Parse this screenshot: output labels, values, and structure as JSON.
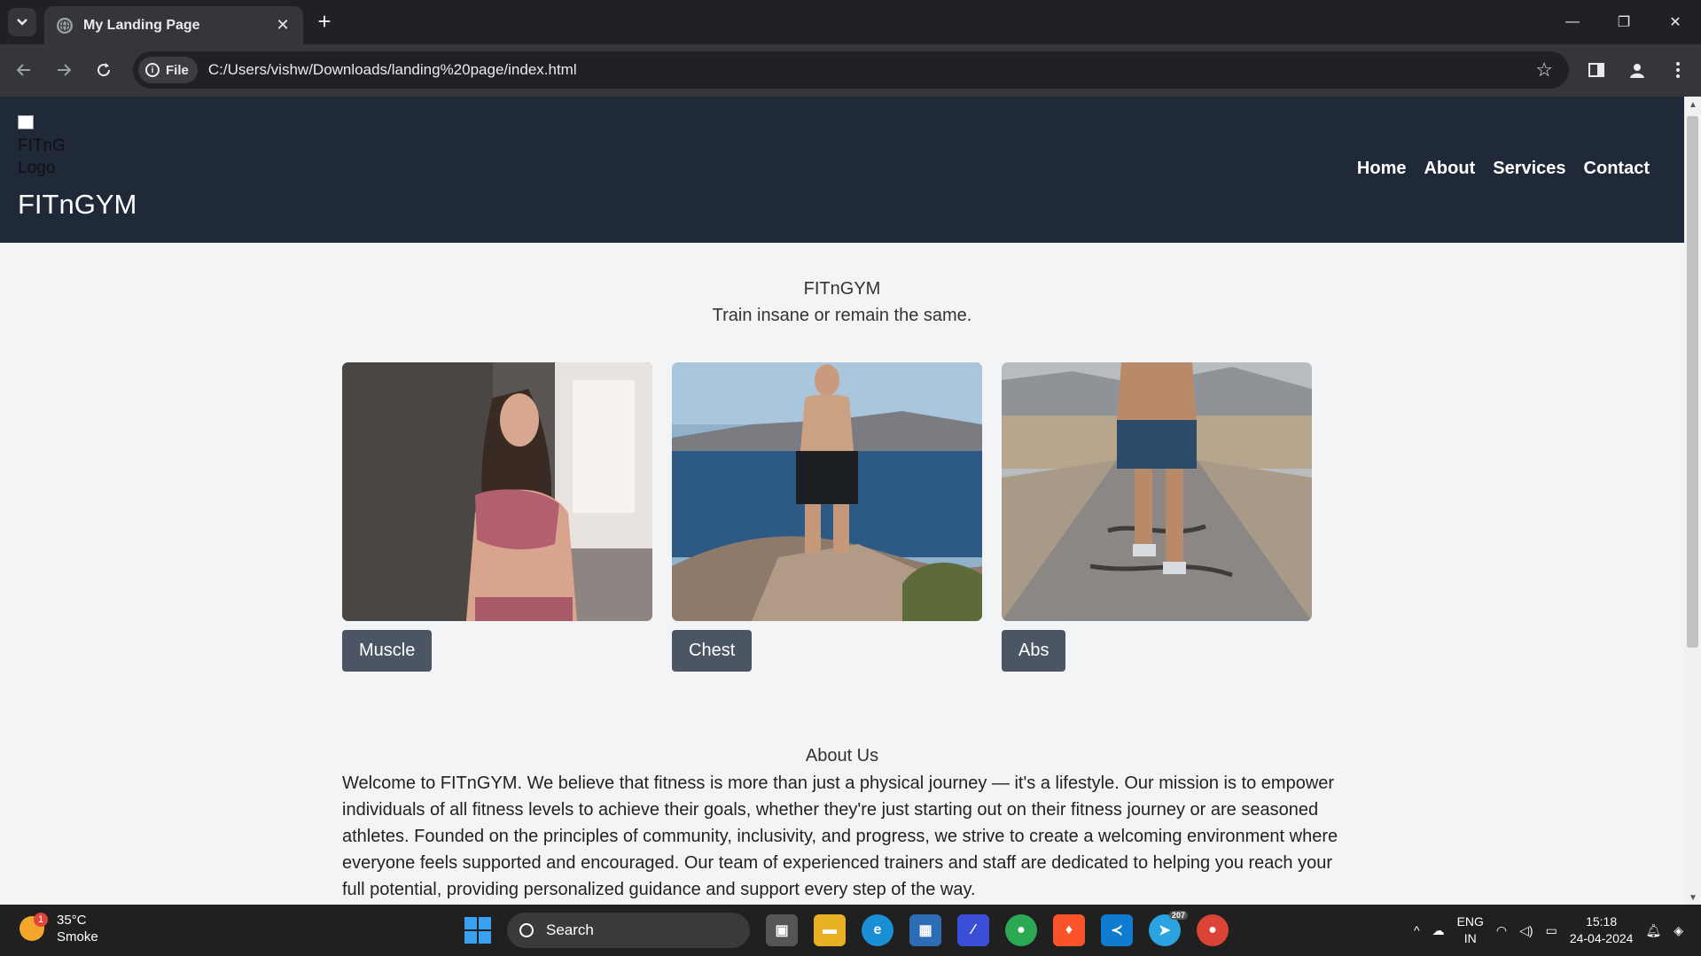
{
  "browser": {
    "tab_title": "My Landing Page",
    "url": "C:/Users/vishw/Downloads/landing%20page/index.html",
    "chip_label": "File",
    "icons": [
      "tab-search-icon",
      "globe-icon",
      "close-icon",
      "plus-icon",
      "back-icon",
      "forward-icon",
      "reload-icon",
      "info-icon",
      "star-icon",
      "sidebar-icon",
      "profile-icon",
      "menu-icon"
    ]
  },
  "site": {
    "logo_alt": "FITnGYM Logo",
    "brand": "FITnGYM",
    "nav": [
      "Home",
      "About",
      "Services",
      "Contact"
    ],
    "hero_title": "FITnGYM",
    "hero_tagline": "Train insane or remain the same.",
    "cards": [
      {
        "label": "Muscle"
      },
      {
        "label": "Chest"
      },
      {
        "label": "Abs"
      }
    ],
    "about_title": "About Us",
    "about_text": "Welcome to FITnGYM. We believe that fitness is more than just a physical journey — it's a lifestyle. Our mission is to empower individuals of all fitness levels to achieve their goals, whether they're just starting out on their fitness journey or are seasoned athletes. Founded on the principles of community, inclusivity, and progress, we strive to create a welcoming environment where everyone feels supported and encouraged. Our team of experienced trainers and staff are dedicated to helping you reach your full potential, providing personalized guidance and support every step of the way."
  },
  "taskbar": {
    "weather_temp": "35°C",
    "weather_desc": "Smoke",
    "weather_badge": "1",
    "search_label": "Search",
    "lang_top": "ENG",
    "lang_bottom": "IN",
    "time": "15:18",
    "date": "24-04-2024",
    "telegram_badge": "207"
  }
}
